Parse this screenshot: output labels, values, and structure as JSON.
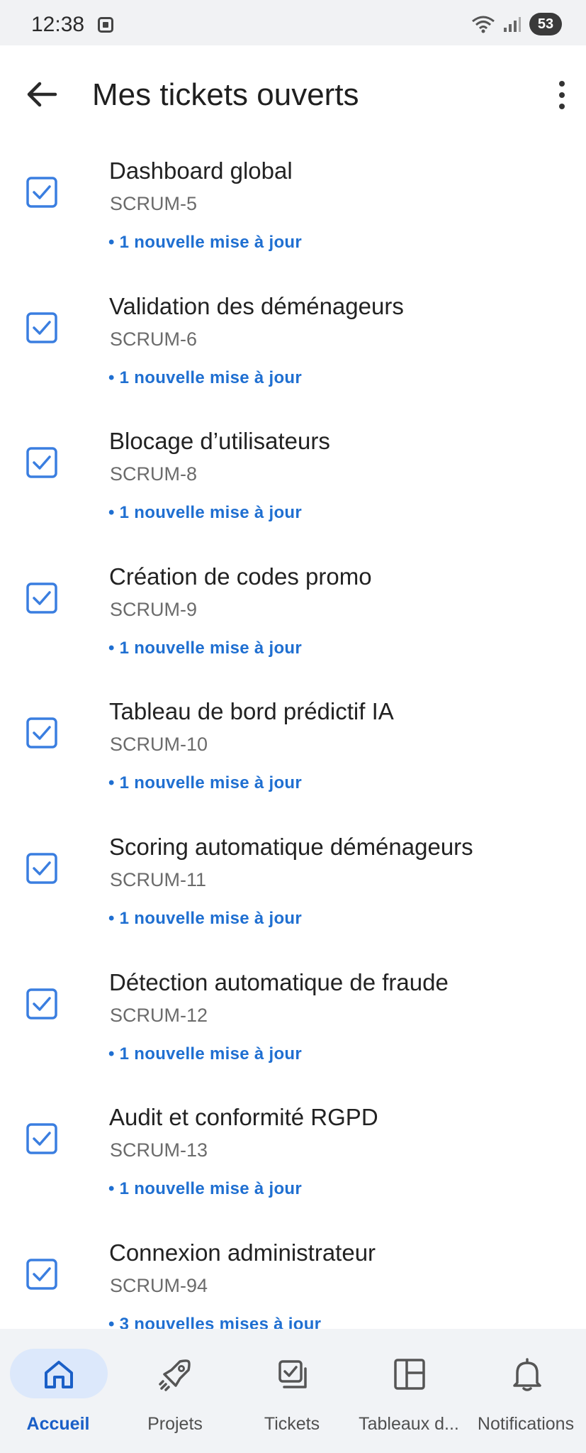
{
  "status": {
    "time": "12:38",
    "battery": "53"
  },
  "header": {
    "title": "Mes tickets ouverts"
  },
  "tickets": [
    {
      "title": "Dashboard global",
      "key": "SCRUM-5",
      "update": "• 1 nouvelle mise à jour"
    },
    {
      "title": "Validation des déménageurs",
      "key": "SCRUM-6",
      "update": "• 1 nouvelle mise à jour"
    },
    {
      "title": "Blocage d’utilisateurs",
      "key": "SCRUM-8",
      "update": "• 1 nouvelle mise à jour"
    },
    {
      "title": "Création de codes promo",
      "key": "SCRUM-9",
      "update": "• 1 nouvelle mise à jour"
    },
    {
      "title": "Tableau de bord prédictif IA",
      "key": "SCRUM-10",
      "update": "• 1 nouvelle mise à jour"
    },
    {
      "title": "Scoring automatique déménageurs",
      "key": "SCRUM-11",
      "update": "• 1 nouvelle mise à jour"
    },
    {
      "title": "Détection automatique de fraude",
      "key": "SCRUM-12",
      "update": "• 1 nouvelle mise à jour"
    },
    {
      "title": "Audit et conformité RGPD",
      "key": "SCRUM-13",
      "update": "• 1 nouvelle mise à jour"
    },
    {
      "title": "Connexion administrateur",
      "key": "SCRUM-94",
      "update": "• 3 nouvelles mises à jour"
    }
  ],
  "nav": [
    {
      "label": "Accueil",
      "icon": "home-icon",
      "active": true
    },
    {
      "label": "Projets",
      "icon": "rocket-icon",
      "active": false
    },
    {
      "label": "Tickets",
      "icon": "tickets-icon",
      "active": false
    },
    {
      "label": "Tableaux d...",
      "icon": "board-icon",
      "active": false
    },
    {
      "label": "Notifications",
      "icon": "bell-icon",
      "active": false
    }
  ],
  "colors": {
    "accent": "#1f6fd1",
    "checkbox": "#3a7ee0",
    "nav_active_pill": "#dce8fb"
  }
}
